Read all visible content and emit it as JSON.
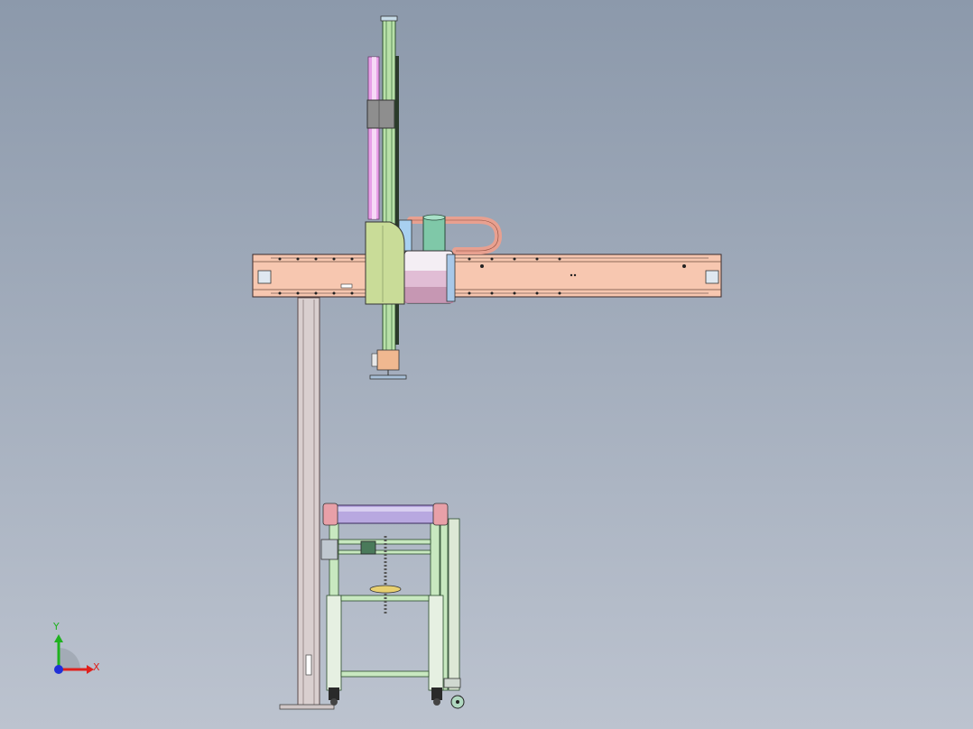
{
  "triad": {
    "x_label": "X",
    "y_label": "Y",
    "x_color": "#e0201c",
    "y_color": "#1fb21f",
    "z_color": "#2030d8"
  },
  "colors": {
    "background_top": "#8c99ab",
    "background_bottom": "#bcc3cf",
    "beam": "#f7c7b0",
    "column": "#d9cfcf",
    "vertical_rail": "#b8e0a8",
    "slide_plate": "#c9dc98",
    "motor_body": "#f4eef4",
    "motor_cap": "#7fc8a8",
    "cable_chain": "#e8a090",
    "magenta_strip": "#e8a0e8",
    "roller": "#b8a8e0",
    "frame": "#c8e8c0"
  }
}
